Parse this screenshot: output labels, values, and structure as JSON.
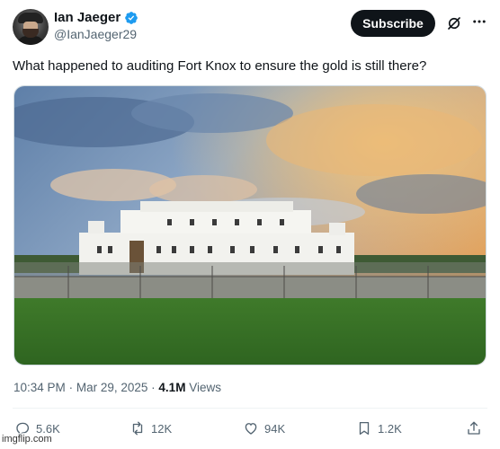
{
  "user": {
    "display_name": "Ian Jaeger",
    "handle": "@IanJaeger29",
    "verified": true,
    "avatar_icon": "avatar-photo"
  },
  "header": {
    "subscribe_label": "Subscribe",
    "grok_icon": "grok-icon",
    "more_icon": "more-icon"
  },
  "tweet": {
    "text": "What happened to auditing Fort Knox to ensure the gold is still there?",
    "media_description_icon": "fort-knox-photo"
  },
  "meta": {
    "time": "10:34 PM",
    "separator1": "·",
    "date": "Mar 29, 2025",
    "separator2": "·",
    "views_count": "4.1M",
    "views_label": "Views"
  },
  "actions": {
    "replies": "5.6K",
    "reposts": "12K",
    "likes": "94K",
    "bookmarks": "1.2K"
  },
  "watermark": {
    "text": "imgflip.com"
  },
  "colors": {
    "text_primary": "#0f1419",
    "text_secondary": "#536471",
    "verified_blue": "#1d9bf0",
    "button_bg": "#0f1419"
  }
}
